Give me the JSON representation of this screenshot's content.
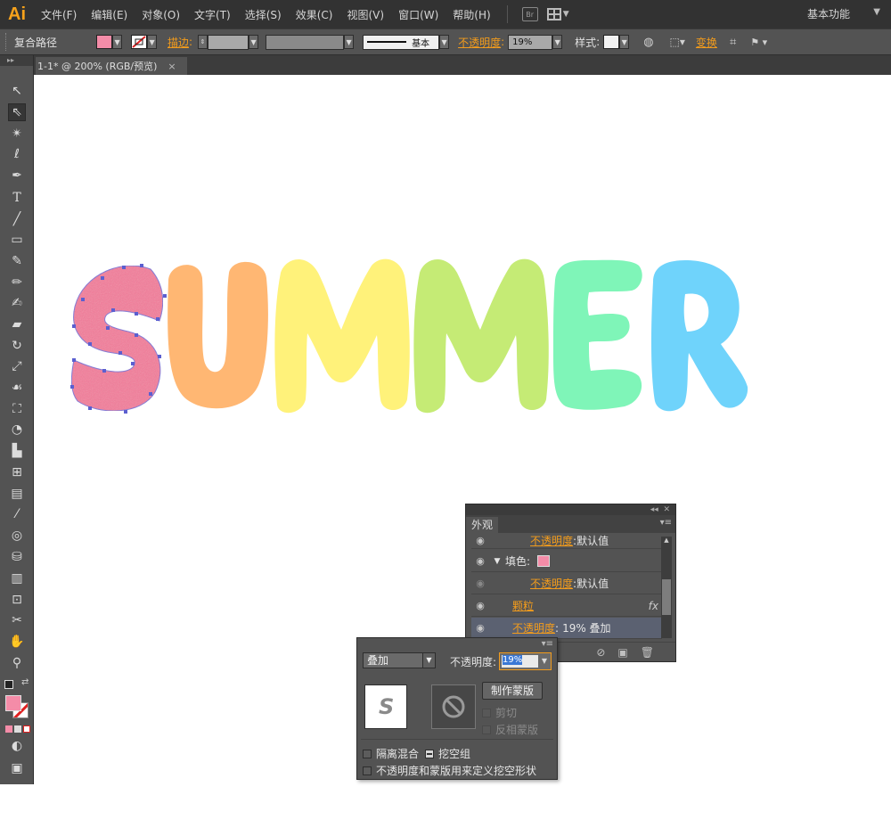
{
  "app": {
    "logo": "Ai",
    "menu": [
      "文件(F)",
      "编辑(E)",
      "对象(O)",
      "文字(T)",
      "选择(S)",
      "效果(C)",
      "视图(V)",
      "窗口(W)",
      "帮助(H)"
    ],
    "bridge_label": "Br",
    "workspace": "基本功能"
  },
  "control_bar": {
    "object_type": "复合路径",
    "stroke_label": "描边",
    "stroke_style": "基本",
    "opacity_label": "不透明度",
    "opacity_value": "19%",
    "style_label": "样式",
    "transform_label": "变换",
    "fill_color": "#f48ca8"
  },
  "document": {
    "tab_title": "1-1* @ 200% (RGB/预览)",
    "close": "×"
  },
  "artwork": {
    "letters": [
      "S",
      "U",
      "M",
      "M",
      "E",
      "R"
    ],
    "colors": [
      "#f47a9a",
      "#ffb773",
      "#fff27a",
      "#c5eb75",
      "#7ff5b8",
      "#6fd3fb"
    ]
  },
  "appearance_panel": {
    "tab": "外观",
    "rows": [
      {
        "label": "不透明度",
        "value": "默认值"
      },
      {
        "label": "填色",
        "value": ""
      },
      {
        "label": "不透明度",
        "value": "默认值"
      },
      {
        "label": "颗粒",
        "value": ""
      },
      {
        "label": "不透明度",
        "value": "19% 叠加"
      }
    ],
    "fx": "fx"
  },
  "transparency_popup": {
    "blend_mode": "叠加",
    "opacity_label": "不透明度:",
    "opacity_value": "19%",
    "thumb_letter": "S",
    "make_mask": "制作蒙版",
    "clip": "剪切",
    "invert_mask": "反相蒙版",
    "isolate_blending": "隔离混合",
    "knockout_group": "挖空组",
    "opacity_mask_knockout": "不透明度和蒙版用来定义挖空形状"
  }
}
